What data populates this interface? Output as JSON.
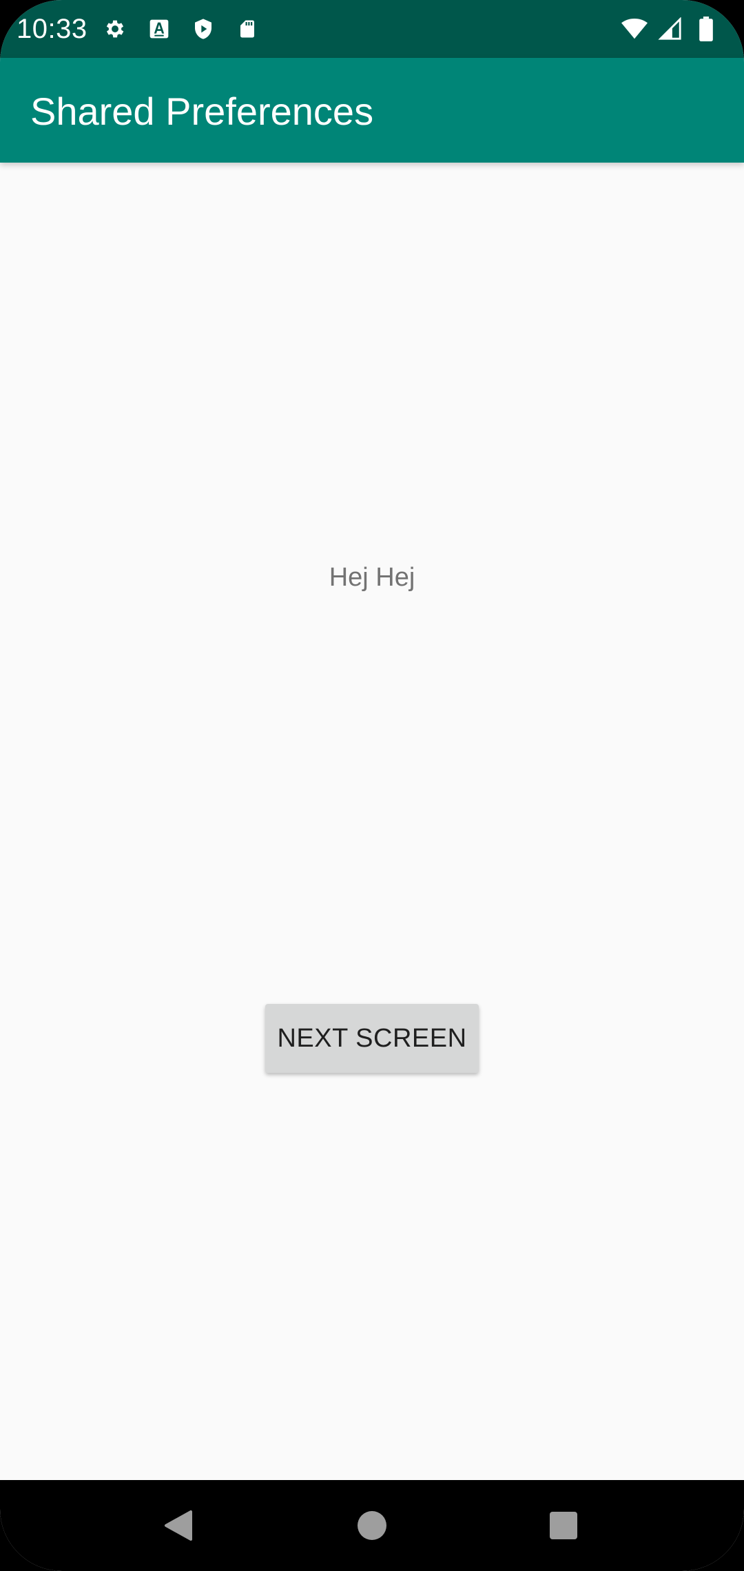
{
  "status_bar": {
    "time": "10:33",
    "left_icons": [
      "gear-icon",
      "font-a-icon",
      "shield-play-icon",
      "sd-card-icon"
    ],
    "right_icons": [
      "wifi-icon",
      "cell-signal-icon",
      "battery-icon"
    ],
    "background": "#00574b"
  },
  "app_bar": {
    "title": "Shared Preferences",
    "background": "#008577"
  },
  "main": {
    "message": "Hej Hej",
    "next_button_label": "NEXT SCREEN"
  },
  "nav_bar": {
    "buttons": [
      "back-icon",
      "home-icon",
      "recents-icon"
    ]
  }
}
